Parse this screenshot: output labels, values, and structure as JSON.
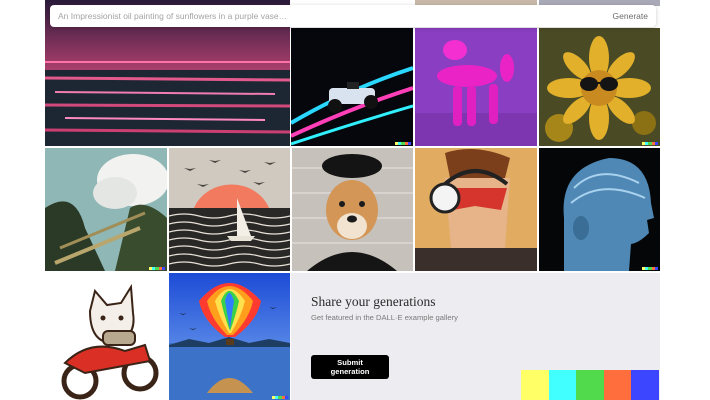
{
  "prompt": {
    "placeholder": "An Impressionist oil painting of sunflowers in a purple vase…",
    "value": "",
    "generate_label": "Generate"
  },
  "gallery": {
    "tiles": [
      {
        "name": "tile-neon-ocean",
        "subject": "neon sunset over dark ocean"
      },
      {
        "name": "tile-neon-race-car",
        "subject": "formula car with neon light trails"
      },
      {
        "name": "tile-balloon-dog",
        "subject": "pink balloon dog on purple"
      },
      {
        "name": "tile-sunflower-sunglasses",
        "subject": "sunflower wearing sunglasses"
      },
      {
        "name": "tile-cloud-sculpture",
        "subject": "mossy tower with clouds"
      },
      {
        "name": "tile-sailboat-birds",
        "subject": "sailboat, waves, sun and birds"
      },
      {
        "name": "tile-shiba-beret",
        "subject": "shiba inu in beret and turtleneck"
      },
      {
        "name": "tile-comic-hero",
        "subject": "comic hero with headphones and mask"
      },
      {
        "name": "tile-blue-head",
        "subject": "translucent blue human head profile"
      },
      {
        "name": "tile-cat-motorcycle",
        "subject": "cartoon cat riding red motorcycle"
      },
      {
        "name": "tile-hot-air-balloon",
        "subject": "rainbow hot air balloon over lake"
      }
    ]
  },
  "share": {
    "title": "Share your generations",
    "subtitle": "Get featured in the DALL·E example gallery",
    "submit_label": "Submit generation"
  },
  "colors": {
    "mark": [
      "#ffff66",
      "#42ffff",
      "#51da4c",
      "#ff6e3c",
      "#3c46ff"
    ],
    "palette": [
      "#ffff66",
      "#42ffff",
      "#51da4c",
      "#ff6e3c",
      "#3c46ff"
    ],
    "panel_bg": "#ececf1",
    "button_bg": "#000000"
  }
}
